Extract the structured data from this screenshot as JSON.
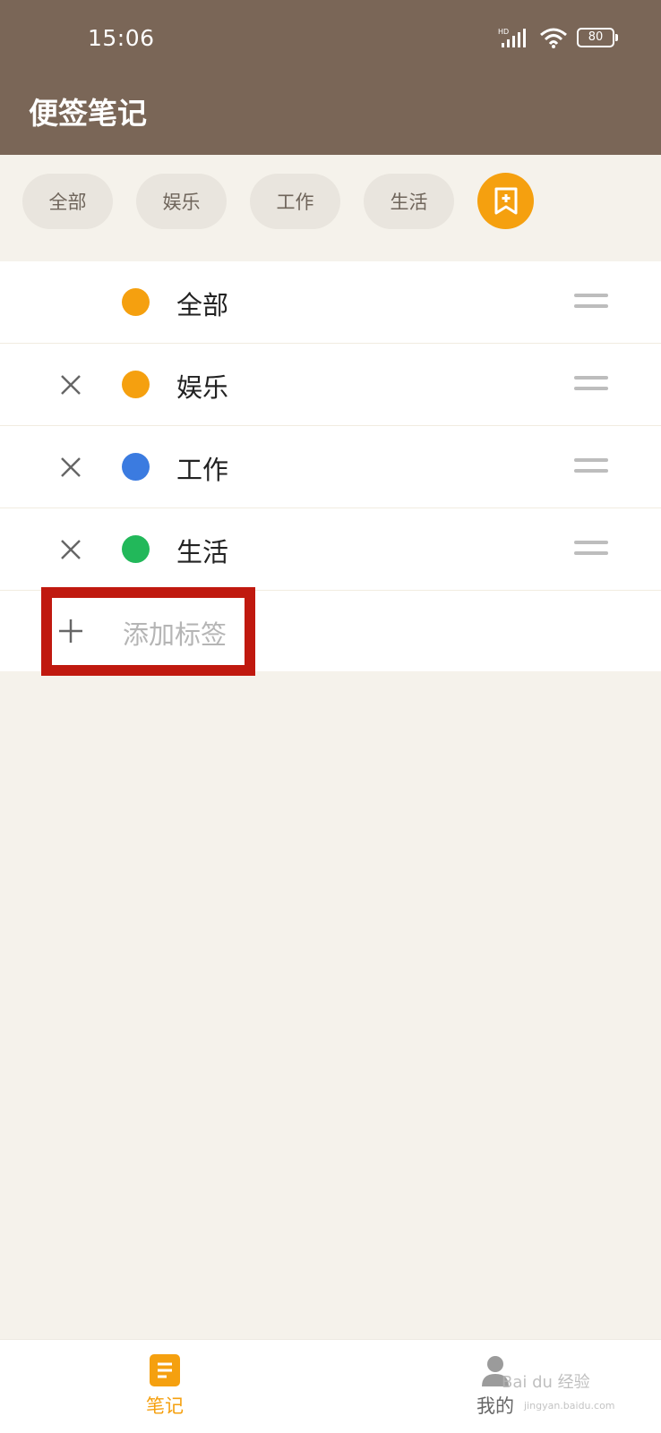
{
  "status_bar": {
    "time": "15:06",
    "network": "HD",
    "battery": "80"
  },
  "header": {
    "title": "便签笔记"
  },
  "chips": [
    {
      "label": "全部"
    },
    {
      "label": "娱乐"
    },
    {
      "label": "工作"
    },
    {
      "label": "生活"
    }
  ],
  "add_chip_icon": "bookmark-plus-icon",
  "tags": [
    {
      "label": "全部",
      "color": "#f5a00f",
      "removable": false
    },
    {
      "label": "娱乐",
      "color": "#f5a00f",
      "removable": true
    },
    {
      "label": "工作",
      "color": "#3b7be0",
      "removable": true
    },
    {
      "label": "生活",
      "color": "#22b85a",
      "removable": true
    }
  ],
  "add_tag": {
    "label": "添加标签"
  },
  "bottom_nav": {
    "notes_label": "笔记",
    "mine_label": "我的"
  },
  "watermark": {
    "text": "Bai du 经验",
    "url": "jingyan.baidu.com"
  },
  "colors": {
    "header_bg": "#7a6657",
    "accent": "#f5a00f",
    "page_bg": "#f5f2eb",
    "highlight": "#c0190f"
  }
}
